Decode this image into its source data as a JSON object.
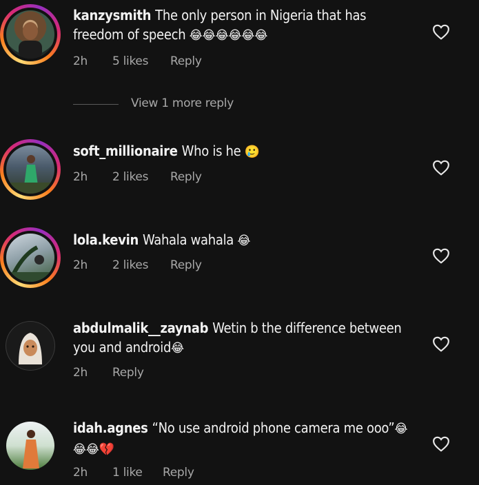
{
  "comments": [
    {
      "username": "kanzysmith",
      "text": "The only person in Nigeria that has freedom of speech",
      "emoji": "😂😂😂😂😂😂",
      "time": "2h",
      "likes": "5 likes",
      "reply": "Reply",
      "avatar_icon": "user-photo-avatar",
      "story_ring": true
    },
    {
      "username": "soft_millionaire",
      "text": "Who is he",
      "emoji": "🥲",
      "time": "2h",
      "likes": "2 likes",
      "reply": "Reply",
      "avatar_icon": "user-photo-avatar",
      "story_ring": true
    },
    {
      "username": "lola.kevin",
      "text": "Wahala wahala",
      "emoji": "😂",
      "time": "2h",
      "likes": "2 likes",
      "reply": "Reply",
      "avatar_icon": "user-photo-avatar",
      "story_ring": true
    },
    {
      "username": "abdulmalik__zaynab",
      "text": "Wetin b the difference between you and android",
      "emoji": "😂",
      "time": "2h",
      "likes": "",
      "reply": "Reply",
      "avatar_icon": "memoji-avatar",
      "story_ring": false
    },
    {
      "username": "idah.agnes",
      "text": "“No use android phone camera me ooo”",
      "emoji": "😂😂😂💔",
      "time": "2h",
      "likes": "1 like",
      "reply": "Reply",
      "avatar_icon": "user-photo-avatar",
      "story_ring": false
    }
  ],
  "view_more_replies": "View 1 more reply",
  "colors": {
    "background": "#121212",
    "text": "#f2f2f2",
    "muted": "#a8a8a8",
    "ring_gradient": [
      "#feda75",
      "#fa7e1e",
      "#d62976",
      "#962fbf"
    ]
  }
}
